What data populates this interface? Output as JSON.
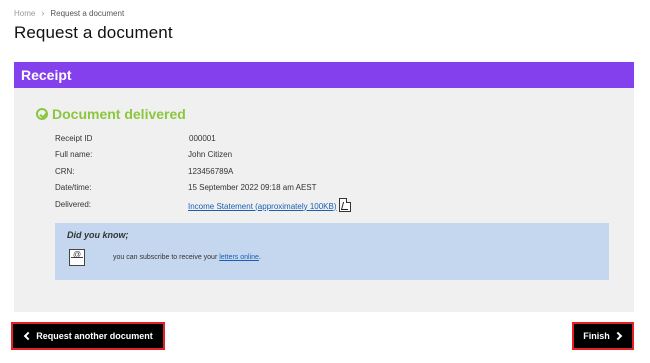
{
  "breadcrumb": {
    "home": "Home",
    "separator": "›",
    "current": "Request a document"
  },
  "page": {
    "title": "Request a document"
  },
  "receipt": {
    "header": "Receipt",
    "status": "Document delivered",
    "rows": [
      {
        "label": "Receipt ID",
        "value": "000001"
      },
      {
        "label": "Full name:",
        "value": "John Citizen"
      },
      {
        "label": "CRN:",
        "value": "123456789A"
      },
      {
        "label": "Date/time:",
        "value": "15 September 2022 09:18 am AEST"
      },
      {
        "label": "Delivered:",
        "value": "Income Statement (approximately 100KB)"
      }
    ]
  },
  "info": {
    "title": "Did you know;",
    "text_prefix": "you can subscribe to receive your ",
    "link": "letters online",
    "text_suffix": "."
  },
  "buttons": {
    "back": "Request another document",
    "finish": "Finish"
  },
  "colors": {
    "header": "#8540ee",
    "status": "#8cc63e",
    "info_bg": "#c4d7ef",
    "button_border": "#e8202a"
  }
}
